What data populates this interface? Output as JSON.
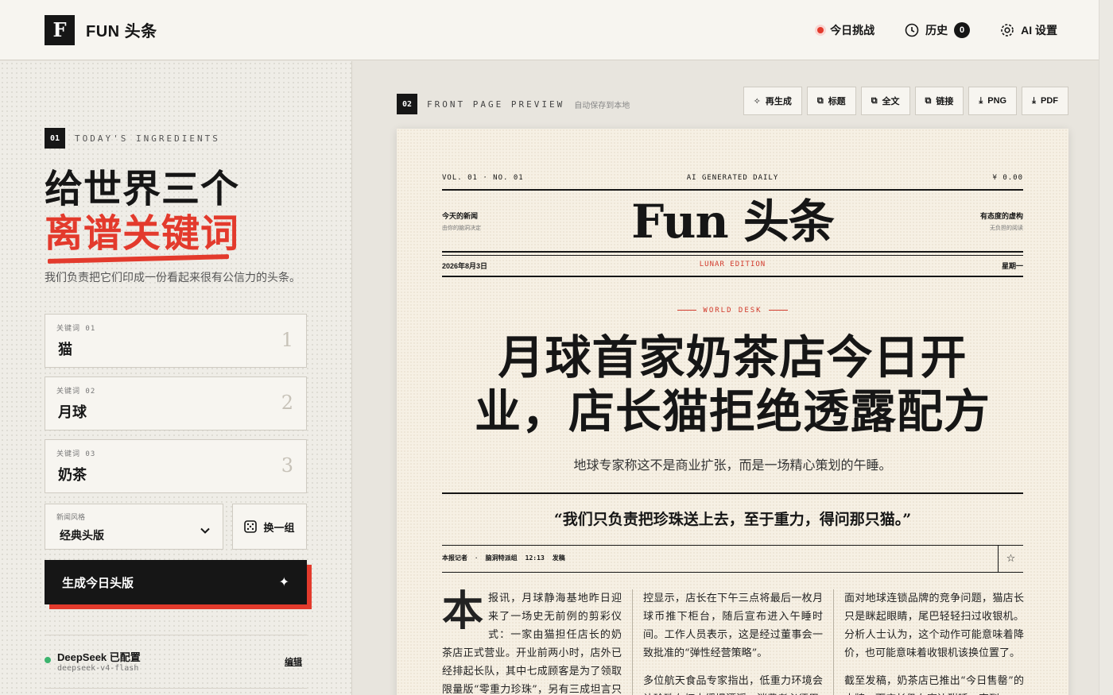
{
  "header": {
    "logo_letter": "F",
    "app_name": "FUN 头条",
    "actions": {
      "challenge": "今日挑战",
      "history": "历史",
      "history_count": "0",
      "ai_settings": "AI 设置"
    }
  },
  "left": {
    "section_num": "01",
    "section_title": "TODAY'S INGREDIENTS",
    "hero_line1": "给世界三个",
    "hero_line2": "离谱关键词",
    "hero_sub": "我们负责把它们印成一份看起来很有公信力的头条。",
    "keywords": [
      {
        "label": "关键词 01",
        "value": "猫",
        "num": "1"
      },
      {
        "label": "关键词 02",
        "value": "月球",
        "num": "2"
      },
      {
        "label": "关键词 03",
        "value": "奶茶",
        "num": "3"
      }
    ],
    "style_label": "新闻风格",
    "style_value": "经典头版",
    "shuffle_label": "换一组",
    "generate_label": "生成今日头版",
    "provider": {
      "title": "DeepSeek 已配置",
      "model": "deepseek-v4-flash",
      "edit": "编辑"
    }
  },
  "preview": {
    "section_num": "02",
    "section_title": "FRONT PAGE PREVIEW",
    "note": "自动保存到本地",
    "tools": [
      "再生成",
      "标题",
      "全文",
      "链接",
      "PNG",
      "PDF"
    ]
  },
  "paper": {
    "vol": "VOL. 01 · NO. 01",
    "daily": "AI GENERATED DAILY",
    "price": "¥ 0.00",
    "ear_left_title": "今天的新闻",
    "ear_left_sub": "由你的脑洞决定",
    "ear_right_title": "有态度的虚构",
    "ear_right_sub": "无负担的阅读",
    "masthead": "Fun 头条",
    "date": "2026年8月3日",
    "edition": "LUNAR EDITION",
    "weekday": "星期一",
    "desk": "WORLD DESK",
    "headline": "月球首家奶茶店今日开业，店长猫拒绝透露配方",
    "subhead": "地球专家称这不是商业扩张，而是一场精心策划的午睡。",
    "quote": "“我们只负责把珍珠送上去，至于重力，得问那只猫。”",
    "byline": [
      "本报记者",
      "·",
      "脑洞特派组",
      "12:13",
      "发稿"
    ],
    "dropcap": "本",
    "col1": "报讯，月球静海基地昨日迎来了一场史无前例的剪彩仪式：一家由猫担任店长的奶茶店正式营业。开业前两小时，店外已经排起长队，其中七成顾客是为了领取限量版“零重力珍珠”，另有三成坦言只是想",
    "col2_p1": "控显示，店长在下午三点将最后一枚月球币推下柜台，随后宣布进入午睡时间。工作人员表示，这是经过董事会一致批准的“弹性经营策略”。",
    "col2_p2": "多位航天食品专家指出，低重力环境会让珍珠在杯中缓慢漂浮，消费者必须用",
    "col3_p1": "面对地球连锁品牌的竞争问题，猫店长只是眯起眼睛，尾巴轻轻扫过收银机。分析人士认为，这个动作可能意味着降价，也可能意味着收银机该换位置了。",
    "col3_p2": "截至发稿，奶茶店已推出“今日售罄”的木牌，而店长仍在窗边酣睡，直到"
  }
}
